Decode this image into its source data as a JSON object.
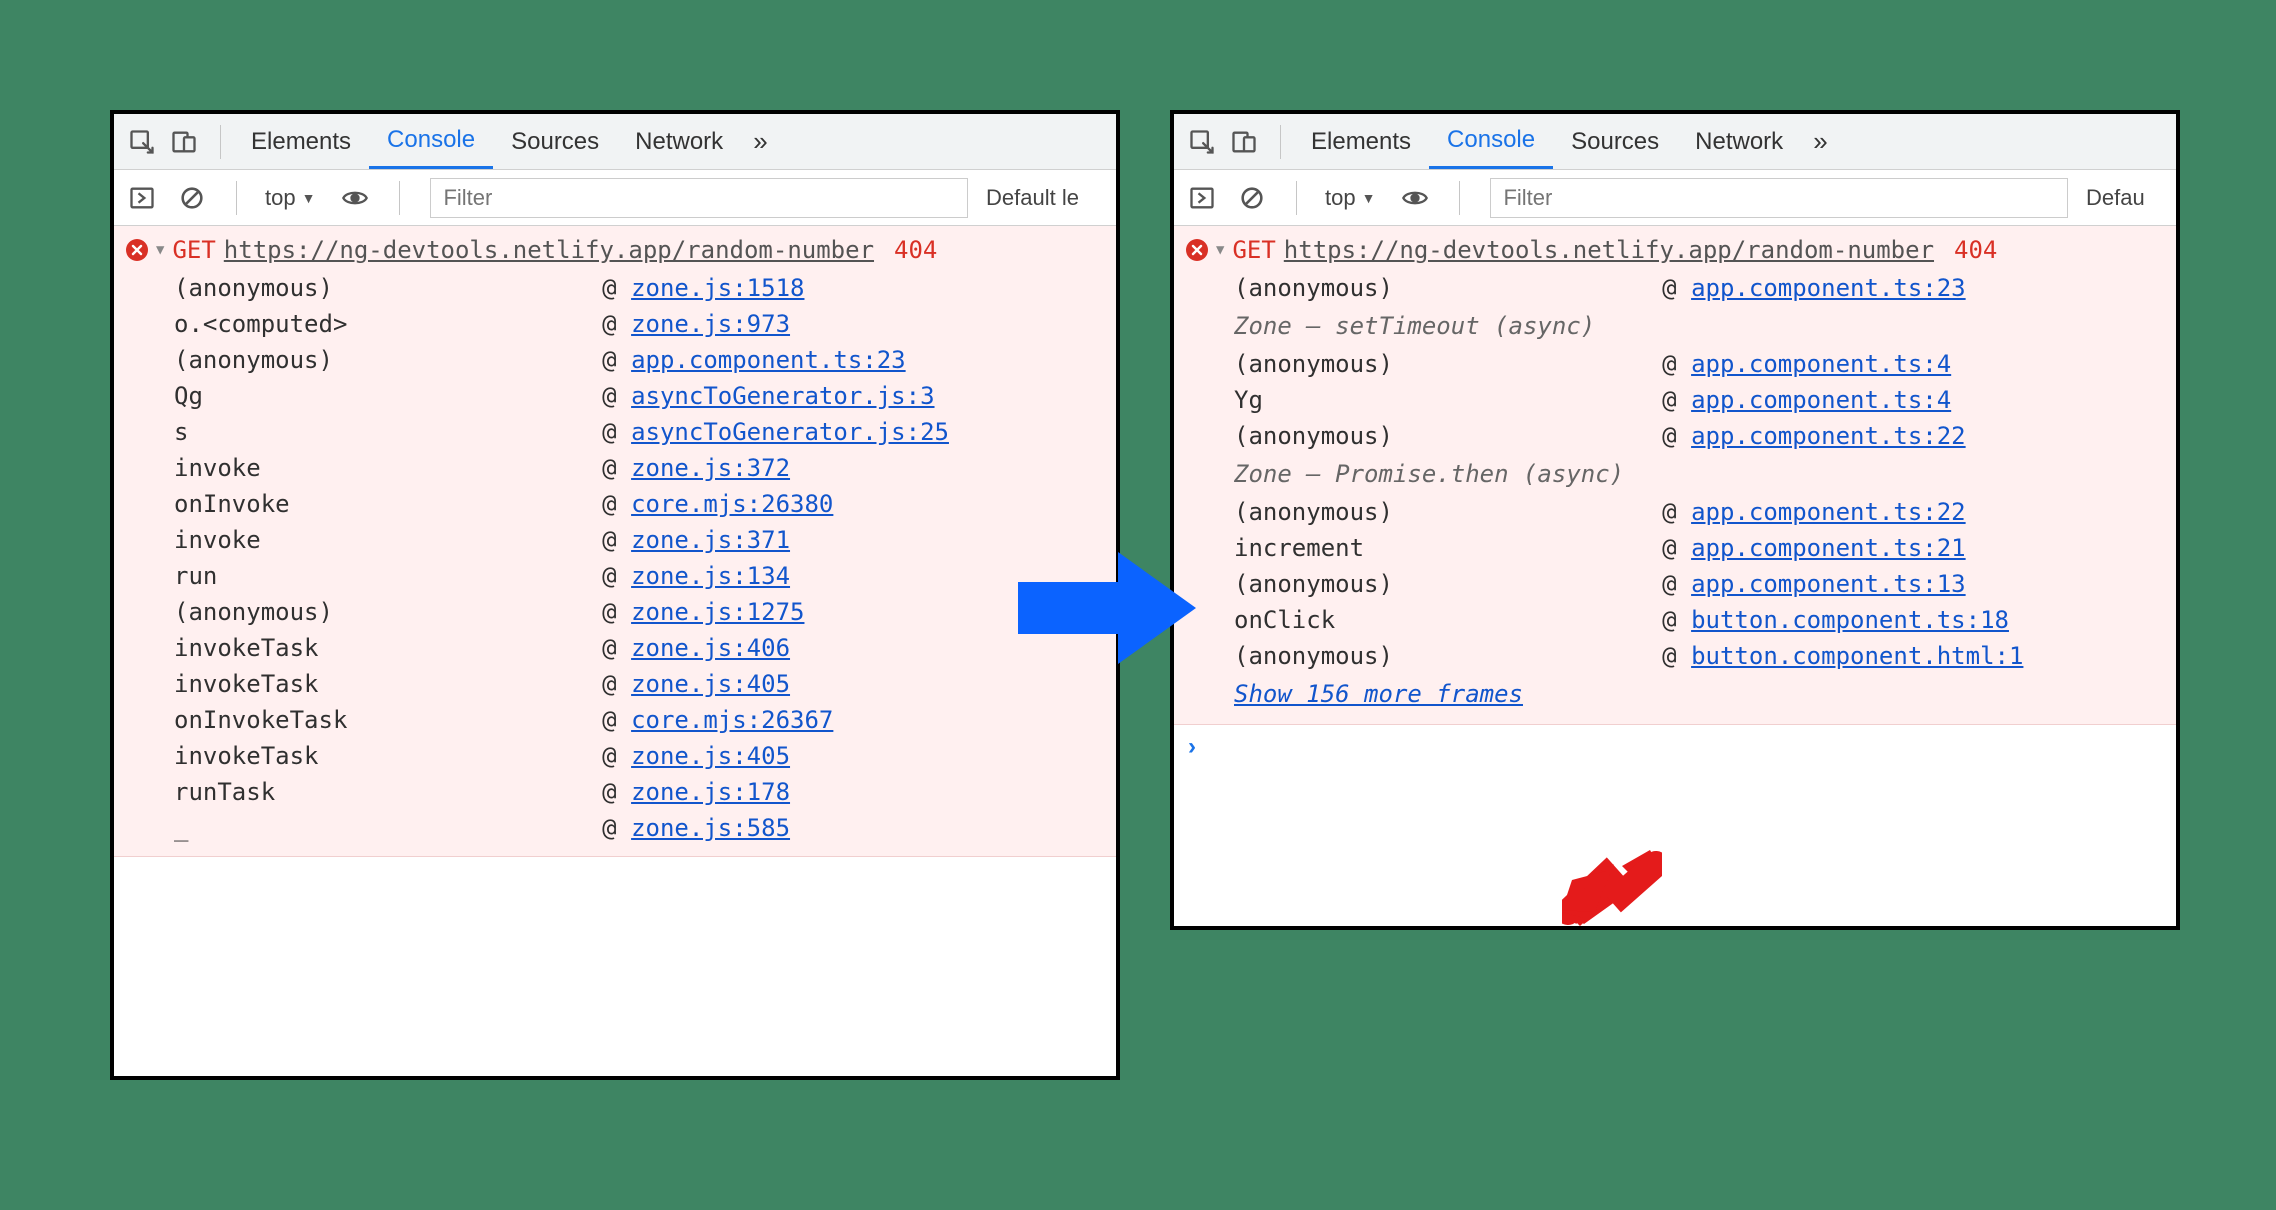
{
  "tabs": {
    "elements": "Elements",
    "console": "Console",
    "sources": "Sources",
    "network": "Network"
  },
  "toolbar": {
    "context": "top",
    "filter_placeholder": "Filter",
    "level_left": "Default le",
    "level_right": "Defau"
  },
  "error": {
    "method": "GET",
    "url": "https://ng-devtools.netlify.app/random-number",
    "status": "404"
  },
  "left_stack": [
    {
      "fn": "(anonymous)",
      "loc": "zone.js:1518"
    },
    {
      "fn": "o.<computed>",
      "loc": "zone.js:973"
    },
    {
      "fn": "(anonymous)",
      "loc": "app.component.ts:23"
    },
    {
      "fn": "Qg",
      "loc": "asyncToGenerator.js:3"
    },
    {
      "fn": "s",
      "loc": "asyncToGenerator.js:25"
    },
    {
      "fn": "invoke",
      "loc": "zone.js:372"
    },
    {
      "fn": "onInvoke",
      "loc": "core.mjs:26380"
    },
    {
      "fn": "invoke",
      "loc": "zone.js:371"
    },
    {
      "fn": "run",
      "loc": "zone.js:134"
    },
    {
      "fn": "(anonymous)",
      "loc": "zone.js:1275"
    },
    {
      "fn": "invokeTask",
      "loc": "zone.js:406"
    },
    {
      "fn": "invokeTask",
      "loc": "zone.js:405"
    },
    {
      "fn": "onInvokeTask",
      "loc": "core.mjs:26367"
    },
    {
      "fn": "invokeTask",
      "loc": "zone.js:405"
    },
    {
      "fn": "runTask",
      "loc": "zone.js:178"
    },
    {
      "fn": "_",
      "loc": "zone.js:585"
    }
  ],
  "right_stack": {
    "group1": [
      {
        "fn": "(anonymous)",
        "loc": "app.component.ts:23"
      }
    ],
    "zone1": "Zone — setTimeout (async)",
    "group2": [
      {
        "fn": "(anonymous)",
        "loc": "app.component.ts:4"
      },
      {
        "fn": "Yg",
        "loc": "app.component.ts:4"
      },
      {
        "fn": "(anonymous)",
        "loc": "app.component.ts:22"
      }
    ],
    "zone2": "Zone — Promise.then (async)",
    "group3": [
      {
        "fn": "(anonymous)",
        "loc": "app.component.ts:22"
      },
      {
        "fn": "increment",
        "loc": "app.component.ts:21"
      },
      {
        "fn": "(anonymous)",
        "loc": "app.component.ts:13"
      },
      {
        "fn": "onClick",
        "loc": "button.component.ts:18"
      },
      {
        "fn": "(anonymous)",
        "loc": "button.component.html:1"
      }
    ],
    "show_more": "Show 156 more frames"
  }
}
